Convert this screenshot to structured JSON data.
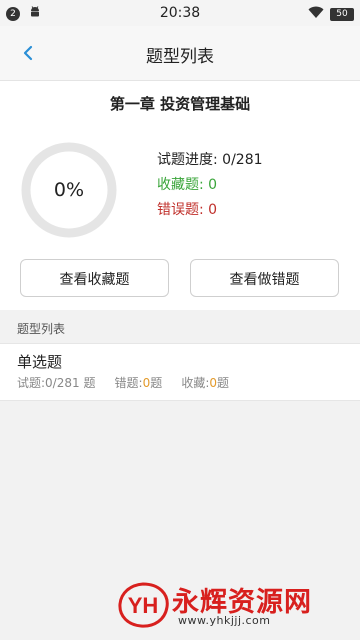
{
  "status_bar": {
    "notification_count": "2",
    "time": "20:38",
    "battery": "50",
    "icons": [
      "android-icon",
      "wifi-icon",
      "battery-icon"
    ]
  },
  "header": {
    "back_icon": "chevron-left-icon",
    "title": "题型列表"
  },
  "summary": {
    "chapter_title": "第一章 投资管理基础",
    "progress_percent": 0,
    "progress_text": "0%",
    "total_label": "试题进度: 0/281",
    "fav_label": "收藏题: 0",
    "wrong_label": "错误题: 0",
    "btn_fav": "查看收藏题",
    "btn_wrong": "查看做错题"
  },
  "section": {
    "label": "题型列表"
  },
  "question_types": [
    {
      "name": "单选题",
      "questions_label": "试题:0/281 题",
      "wrong_prefix": "错题:",
      "wrong_count": "0",
      "wrong_suffix": "题",
      "fav_prefix": "收藏:",
      "fav_count": "0",
      "fav_suffix": "题"
    }
  ],
  "watermark": {
    "brand": "永辉资源网",
    "url": "www.yhkjjj.com",
    "logo_text": "YH"
  },
  "colors": {
    "accent_blue": "#2a8fd6",
    "fav_green": "#3aa53a",
    "wrong_red": "#c0302b",
    "count_orange": "#e39a2b",
    "ring_gray": "#e5e5e5",
    "watermark_red": "#d8201e"
  }
}
